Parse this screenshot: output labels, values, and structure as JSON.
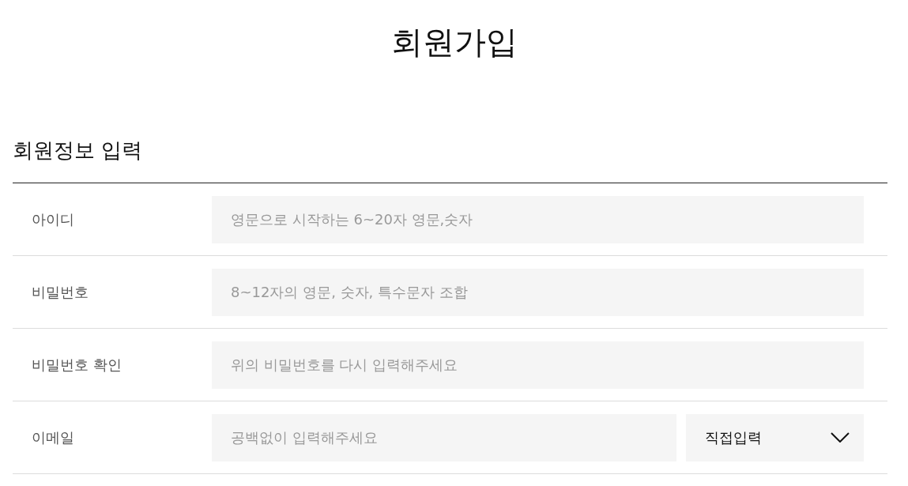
{
  "page": {
    "title": "회원가입"
  },
  "section": {
    "title": "회원정보 입력"
  },
  "form": {
    "rows": [
      {
        "kind": "text",
        "label": "아이디",
        "placeholder": "영문으로 시작하는 6~20자 영문,숫자"
      },
      {
        "kind": "password",
        "label": "비밀번호",
        "placeholder": "8~12자의 영문, 숫자, 특수문자 조합"
      },
      {
        "kind": "password",
        "label": "비밀번호 확인",
        "placeholder": "위의 비밀번호를 다시 입력해주세요"
      },
      {
        "kind": "email",
        "label": "이메일",
        "placeholder": "공백없이 입력해주세요",
        "domain_select": {
          "value": "직접입력"
        }
      }
    ]
  }
}
